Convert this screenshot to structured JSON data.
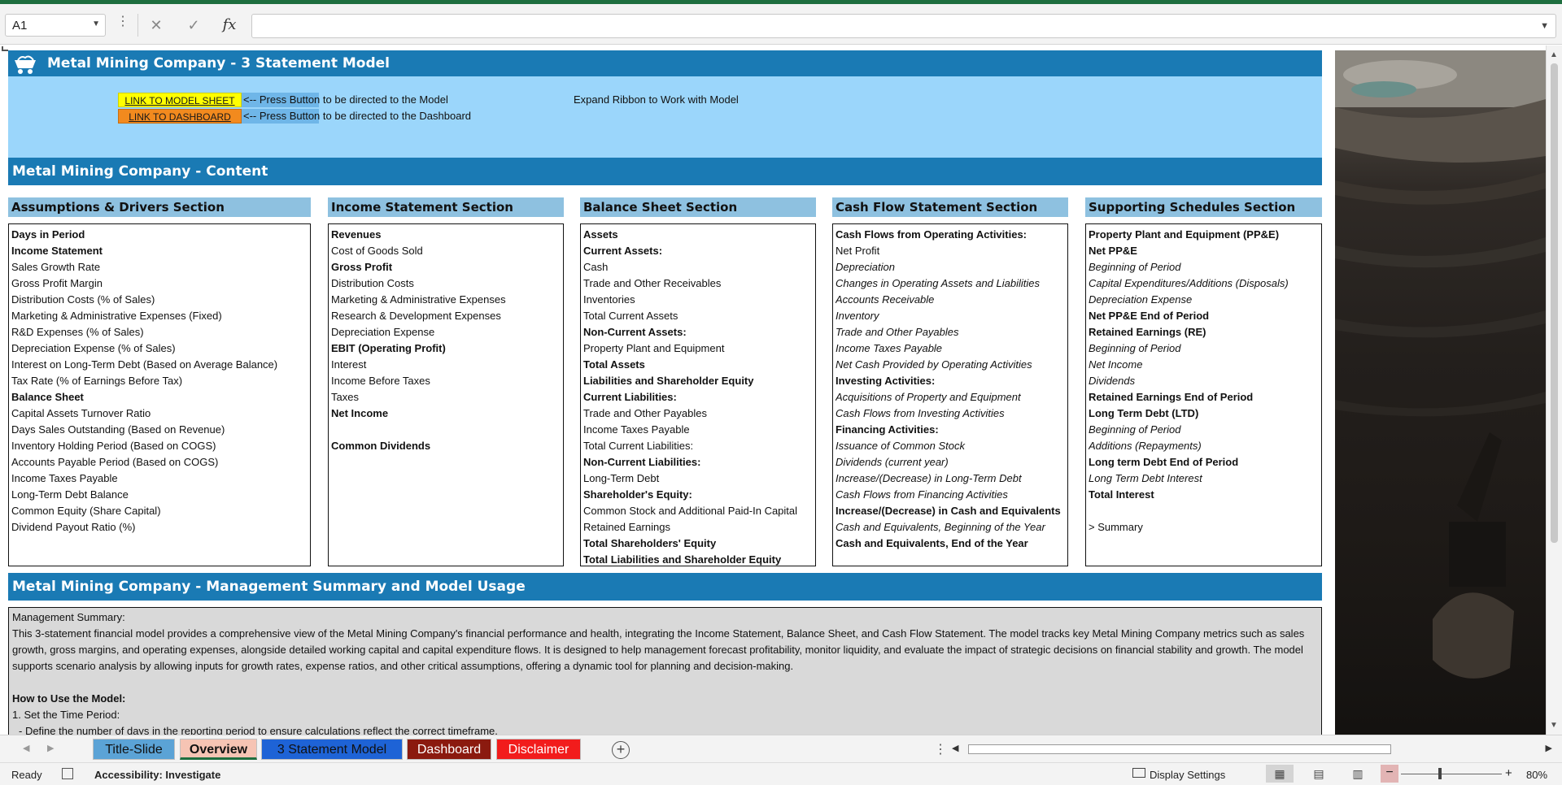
{
  "formula_bar": {
    "cell_ref": "A1",
    "formula": ""
  },
  "header": {
    "title": "Metal Mining Company - 3 Statement Model",
    "link_model": "LINK TO MODEL SHEET",
    "link_dashboard": "LINK TO DASHBOARD",
    "press_model": "<-- Press Button to be directed to the Model",
    "press_dashboard": "<-- Press Button to be directed to the Dashboard",
    "expand_ribbon": "Expand Ribbon to Work with Model"
  },
  "content_title": "Metal Mining Company - Content",
  "sections": [
    {
      "title": "Assumptions & Drivers Section",
      "rows": [
        {
          "text": "Days in Period",
          "style": "b"
        },
        {
          "text": "Income Statement",
          "style": "b"
        },
        {
          "text": "Sales Growth Rate",
          "style": ""
        },
        {
          "text": "Gross Profit Margin",
          "style": ""
        },
        {
          "text": "Distribution Costs (% of Sales)",
          "style": ""
        },
        {
          "text": "Marketing & Administrative Expenses (Fixed)",
          "style": ""
        },
        {
          "text": "R&D Expenses (% of Sales)",
          "style": ""
        },
        {
          "text": "Depreciation Expense (% of Sales)",
          "style": ""
        },
        {
          "text": "Interest on Long-Term Debt (Based on Average Balance)",
          "style": ""
        },
        {
          "text": "Tax Rate (% of Earnings Before Tax)",
          "style": ""
        },
        {
          "text": "Balance Sheet",
          "style": "b"
        },
        {
          "text": "Capital Assets Turnover Ratio",
          "style": ""
        },
        {
          "text": "Days Sales Outstanding (Based on Revenue)",
          "style": ""
        },
        {
          "text": "Inventory Holding Period (Based on COGS)",
          "style": ""
        },
        {
          "text": "Accounts Payable Period (Based on COGS)",
          "style": ""
        },
        {
          "text": "Income Taxes Payable",
          "style": ""
        },
        {
          "text": "Long-Term Debt Balance",
          "style": ""
        },
        {
          "text": "Common Equity (Share Capital)",
          "style": ""
        },
        {
          "text": "Dividend Payout Ratio (%)",
          "style": ""
        }
      ]
    },
    {
      "title": "Income Statement Section",
      "rows": [
        {
          "text": "Revenues",
          "style": "b"
        },
        {
          "text": "Cost of Goods Sold",
          "style": ""
        },
        {
          "text": "Gross Profit",
          "style": "b"
        },
        {
          "text": "Distribution Costs",
          "style": ""
        },
        {
          "text": "Marketing & Administrative Expenses",
          "style": ""
        },
        {
          "text": "Research & Development Expenses",
          "style": ""
        },
        {
          "text": "Depreciation Expense",
          "style": ""
        },
        {
          "text": "EBIT (Operating Profit)",
          "style": "b"
        },
        {
          "text": "Interest",
          "style": ""
        },
        {
          "text": "Income Before Taxes",
          "style": ""
        },
        {
          "text": "Taxes",
          "style": ""
        },
        {
          "text": "Net Income",
          "style": "b"
        },
        {
          "text": "",
          "style": ""
        },
        {
          "text": "Common Dividends",
          "style": "b"
        }
      ]
    },
    {
      "title": "Balance Sheet Section",
      "rows": [
        {
          "text": "Assets",
          "style": "b"
        },
        {
          "text": "Current Assets:",
          "style": "b"
        },
        {
          "text": "Cash",
          "style": ""
        },
        {
          "text": "Trade and Other Receivables",
          "style": ""
        },
        {
          "text": "Inventories",
          "style": ""
        },
        {
          "text": "Total Current Assets",
          "style": ""
        },
        {
          "text": "Non-Current Assets:",
          "style": "b"
        },
        {
          "text": "Property Plant and Equipment",
          "style": ""
        },
        {
          "text": "Total Assets",
          "style": "b"
        },
        {
          "text": "Liabilities and Shareholder Equity",
          "style": "b"
        },
        {
          "text": "Current Liabilities:",
          "style": "b"
        },
        {
          "text": "Trade and Other Payables",
          "style": ""
        },
        {
          "text": "Income Taxes Payable",
          "style": ""
        },
        {
          "text": "Total Current Liabilities:",
          "style": ""
        },
        {
          "text": "Non-Current Liabilities:",
          "style": "b"
        },
        {
          "text": "Long-Term Debt",
          "style": ""
        },
        {
          "text": "Shareholder's Equity:",
          "style": "b"
        },
        {
          "text": "Common Stock and Additional Paid-In Capital",
          "style": ""
        },
        {
          "text": "Retained Earnings",
          "style": ""
        },
        {
          "text": "Total Shareholders' Equity",
          "style": "b"
        },
        {
          "text": "Total Liabilities and Shareholder Equity",
          "style": "b"
        }
      ]
    },
    {
      "title": "Cash Flow Statement Section",
      "rows": [
        {
          "text": "Cash Flows from Operating Activities:",
          "style": "b"
        },
        {
          "text": "Net Profit",
          "style": ""
        },
        {
          "text": "Depreciation",
          "style": "i"
        },
        {
          "text": "Changes in Operating Assets and Liabilities",
          "style": "i"
        },
        {
          "text": "Accounts Receivable",
          "style": "i"
        },
        {
          "text": "Inventory",
          "style": "i"
        },
        {
          "text": "Trade and Other Payables",
          "style": "i"
        },
        {
          "text": "Income Taxes Payable",
          "style": "i"
        },
        {
          "text": "Net Cash Provided by Operating Activities",
          "style": "i"
        },
        {
          "text": "Investing Activities:",
          "style": "b"
        },
        {
          "text": "Acquisitions of Property and Equipment",
          "style": "i"
        },
        {
          "text": "Cash Flows from Investing Activities",
          "style": "i"
        },
        {
          "text": "Financing Activities:",
          "style": "b"
        },
        {
          "text": "Issuance of Common Stock",
          "style": "i"
        },
        {
          "text": "Dividends (current year)",
          "style": "i"
        },
        {
          "text": "Increase/(Decrease) in Long-Term Debt",
          "style": "i"
        },
        {
          "text": "Cash Flows from Financing Activities",
          "style": "i"
        },
        {
          "text": "Increase/(Decrease) in Cash and Equivalents",
          "style": "b"
        },
        {
          "text": "Cash and Equivalents, Beginning of the Year",
          "style": "i"
        },
        {
          "text": "Cash and Equivalents, End of the Year",
          "style": "b"
        }
      ]
    },
    {
      "title": "Supporting Schedules Section",
      "rows": [
        {
          "text": "Property Plant and Equipment (PP&E)",
          "style": "b"
        },
        {
          "text": "Net PP&E",
          "style": "b"
        },
        {
          "text": "Beginning of Period",
          "style": "i"
        },
        {
          "text": "Capital Expenditures/Additions (Disposals)",
          "style": "i"
        },
        {
          "text": "Depreciation Expense",
          "style": "i"
        },
        {
          "text": "Net PP&E End of Period",
          "style": "b"
        },
        {
          "text": "Retained Earnings (RE)",
          "style": "b"
        },
        {
          "text": "Beginning of Period",
          "style": "i"
        },
        {
          "text": "Net Income",
          "style": "i"
        },
        {
          "text": "Dividends",
          "style": "i"
        },
        {
          "text": "Retained Earnings End of Period",
          "style": "b"
        },
        {
          "text": "Long Term Debt (LTD)",
          "style": "b"
        },
        {
          "text": "Beginning of Period",
          "style": "i"
        },
        {
          "text": "Additions (Repayments)",
          "style": "i"
        },
        {
          "text": "Long term Debt End of Period",
          "style": "b"
        },
        {
          "text": "Long Term Debt Interest",
          "style": "i"
        },
        {
          "text": "Total Interest",
          "style": "b"
        },
        {
          "text": "",
          "style": ""
        },
        {
          "text": "> Summary",
          "style": ""
        }
      ]
    }
  ],
  "management": {
    "title": "Metal Mining Company - Management Summary and Model Usage",
    "label": "Management Summary:",
    "summary": "This 3-statement financial model provides a comprehensive view of the Metal Mining Company's financial performance and health, integrating the Income Statement, Balance Sheet, and Cash Flow Statement. The model tracks key Metal Mining Company metrics such as sales growth, gross margins, and operating expenses, alongside detailed working capital and capital expenditure flows. It is designed to help management forecast profitability, monitor liquidity, and evaluate the impact of strategic decisions on financial stability and growth. The model supports scenario analysis by allowing inputs for growth rates, expense ratios, and other critical assumptions, offering a dynamic tool for planning and decision-making.",
    "how_to": "How to Use the Model:",
    "step1": "1. Set the Time Period:",
    "step1_detail": "- Define the number of days in the reporting period to ensure calculations reflect the correct timeframe."
  },
  "tabs": [
    {
      "label": "Title-Slide"
    },
    {
      "label": "Overview"
    },
    {
      "label": "3 Statement Model"
    },
    {
      "label": "Dashboard"
    },
    {
      "label": "Disclaimer"
    }
  ],
  "statusbar": {
    "ready": "Ready",
    "accessibility": "Accessibility: Investigate",
    "display_settings": "Display Settings",
    "zoom": "80%"
  },
  "colors": {
    "banner": "#1a7ab4",
    "light_band": "#9bd6fb",
    "section_head": "#8ec1e0",
    "link_model_bg": "#ffff00",
    "link_dashboard_bg": "#f28a1e"
  }
}
